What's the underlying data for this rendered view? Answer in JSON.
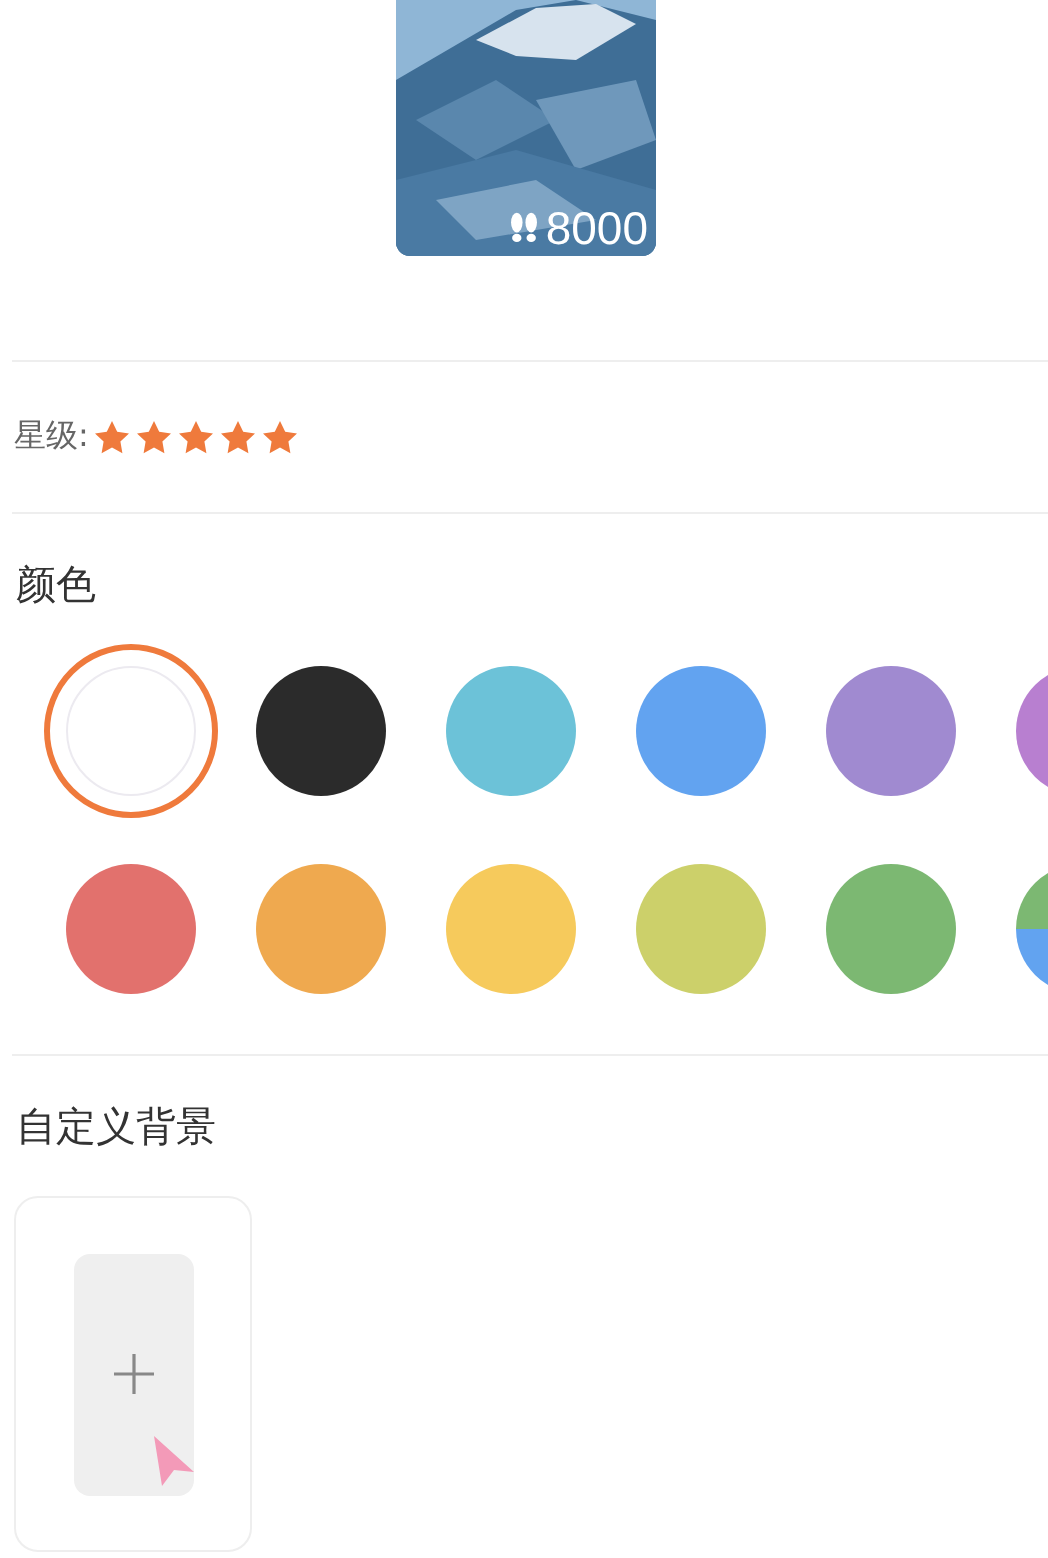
{
  "cover": {
    "kind": "picture",
    "steps": "8000"
  },
  "rating": {
    "label": "星级:",
    "stars": 5
  },
  "color_section": {
    "title": "颜色",
    "swatches": [
      {
        "kind": "solid",
        "color": "#ffffff",
        "selected": true
      },
      {
        "kind": "solid",
        "color": "#2b2b2b",
        "selected": false
      },
      {
        "kind": "solid",
        "color": "#6cc2d8",
        "selected": false
      },
      {
        "kind": "solid",
        "color": "#62a3f0",
        "selected": false
      },
      {
        "kind": "solid",
        "color": "#a08ad0",
        "selected": false
      },
      {
        "kind": "solid",
        "color": "#b87fd0",
        "selected": false
      },
      {
        "kind": "solid",
        "color": "#e2716d",
        "selected": false
      },
      {
        "kind": "solid",
        "color": "#efa94f",
        "selected": false
      },
      {
        "kind": "solid",
        "color": "#f6ca5c",
        "selected": false
      },
      {
        "kind": "solid",
        "color": "#ccd06a",
        "selected": false
      },
      {
        "kind": "solid",
        "color": "#7cb872",
        "selected": false
      },
      {
        "kind": "multi",
        "selected": false
      }
    ]
  },
  "custom_background": {
    "title": "自定义背景"
  }
}
